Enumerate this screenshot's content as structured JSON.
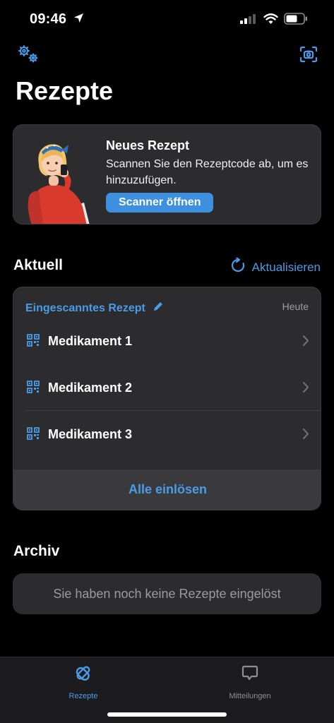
{
  "status_bar": {
    "time": "09:46"
  },
  "header": {
    "title": "Rezepte",
    "settings_icon": "gears-icon",
    "scan_icon": "camera-scan-icon"
  },
  "promo": {
    "title": "Neues Rezept",
    "description": "Scannen Sie den Rezeptcode ab, um es hinzuzufügen.",
    "button_label": "Scanner öffnen"
  },
  "aktuell": {
    "title": "Aktuell",
    "refresh_label": "Aktualisieren",
    "prescription": {
      "title": "Eingescanntes Rezept",
      "date": "Heute",
      "items": [
        {
          "label": "Medikament 1"
        },
        {
          "label": "Medikament 2"
        },
        {
          "label": "Medikament 3"
        }
      ],
      "redeem_all_label": "Alle einlösen"
    }
  },
  "archiv": {
    "title": "Archiv",
    "empty_text": "Sie haben noch keine Rezepte eingelöst"
  },
  "tab_bar": {
    "tabs": [
      {
        "label": "Rezepte",
        "icon": "rezepte-icon",
        "active": true
      },
      {
        "label": "Mitteilungen",
        "icon": "chat-bubble-icon",
        "active": false
      }
    ]
  },
  "colors": {
    "accent": "#4a9ce8",
    "button": "#3d8fe0",
    "card": "#2c2c2e",
    "background": "#000000"
  }
}
